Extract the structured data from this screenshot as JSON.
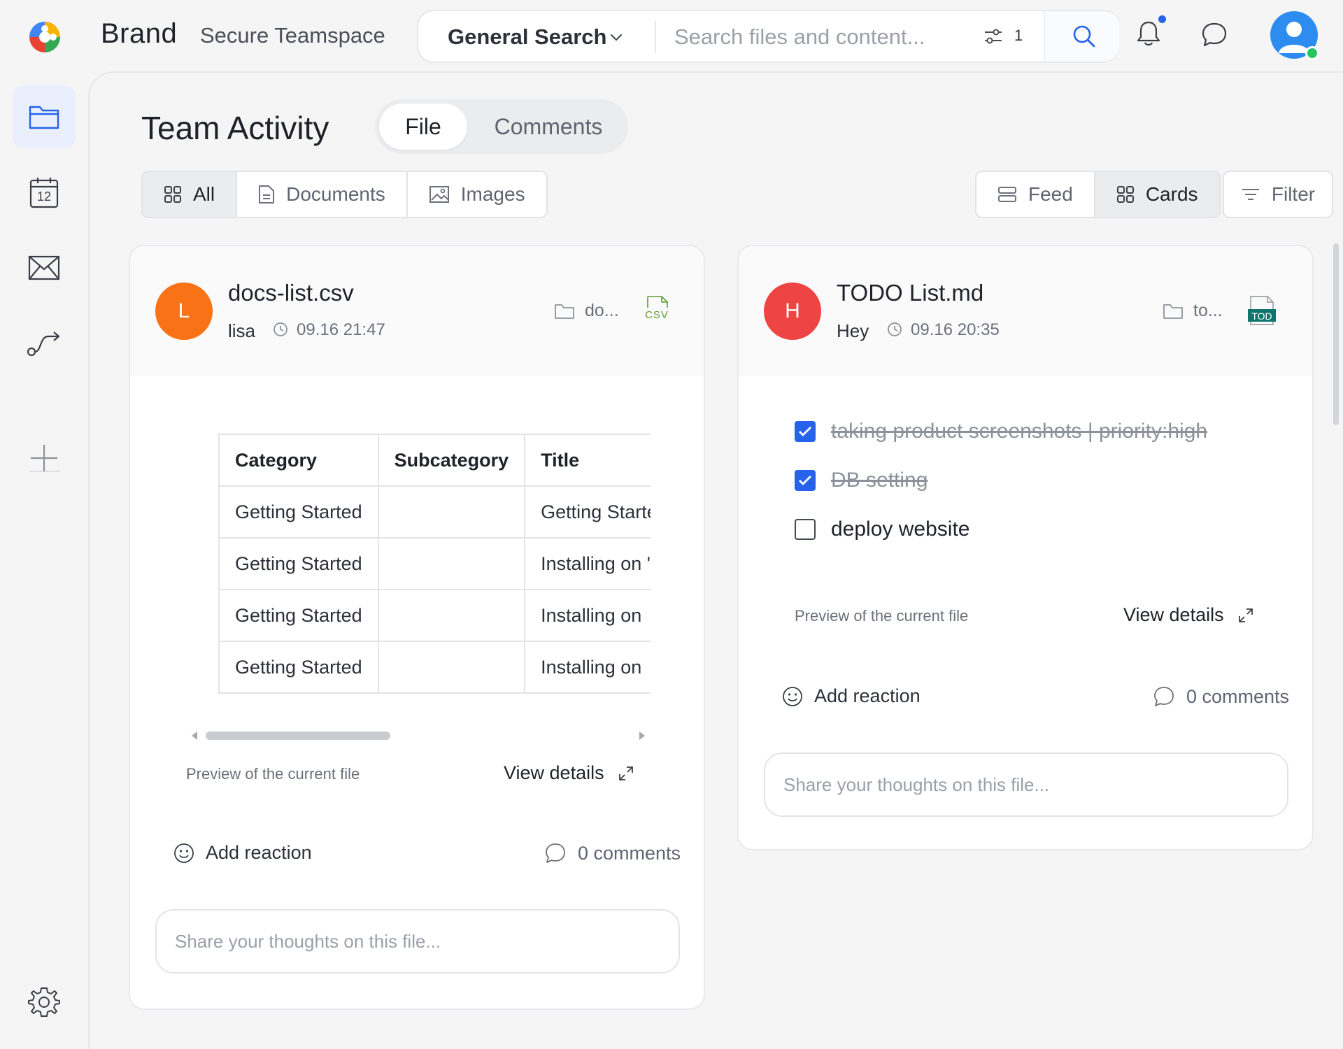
{
  "header": {
    "brand": "Brand",
    "workspace": "Secure Teamspace",
    "search_scope": "General Search",
    "search_placeholder": "Search files and content...",
    "filter_count": "1"
  },
  "page": {
    "title": "Team Activity",
    "toggle": [
      "File",
      "Comments"
    ],
    "type_filters": [
      "All",
      "Documents",
      "Images"
    ],
    "views": [
      "Feed",
      "Cards"
    ],
    "filter_label": "Filter"
  },
  "cards": [
    {
      "avatar_letter": "L",
      "avatar_color": "#f97316",
      "title": "docs-list.csv",
      "author": "lisa",
      "time": "09.16 21:47",
      "folder": "do...",
      "file_badge": "CSV",
      "table": {
        "headers": [
          "Category",
          "Subcategory",
          "Title"
        ],
        "rows": [
          [
            "Getting Started",
            "",
            "Getting Starte"
          ],
          [
            "Getting Started",
            "",
            "Installing on '"
          ],
          [
            "Getting Started",
            "",
            "Installing on"
          ],
          [
            "Getting Started",
            "",
            "Installing on"
          ]
        ]
      },
      "preview_label": "Preview of the current file",
      "view_details": "View details",
      "add_reaction": "Add reaction",
      "comments": "0 comments",
      "comment_placeholder": "Share your thoughts on this file..."
    },
    {
      "avatar_letter": "H",
      "avatar_color": "#ef4444",
      "title": "TODO List.md",
      "author": "Hey",
      "time": "09.16 20:35",
      "folder": "to...",
      "file_badge": "TOD",
      "todos": [
        {
          "text": "taking product screenshots | priority:high",
          "done": true
        },
        {
          "text": "DB setting",
          "done": true
        },
        {
          "text": "deploy website",
          "done": false
        }
      ],
      "preview_label": "Preview of the current file",
      "view_details": "View details",
      "add_reaction": "Add reaction",
      "comments": "0 comments",
      "comment_placeholder": "Share your thoughts on this file..."
    }
  ],
  "colors": {
    "accent": "#2563eb",
    "online": "#22c55e",
    "csv_green": "#5b9c2e",
    "md_teal": "#0f766e"
  },
  "icons": {
    "sidebar": [
      "folder-icon",
      "calendar-icon",
      "mail-icon",
      "workflow-icon",
      "plus-icon",
      "settings-icon"
    ],
    "calendar_day": "12"
  }
}
